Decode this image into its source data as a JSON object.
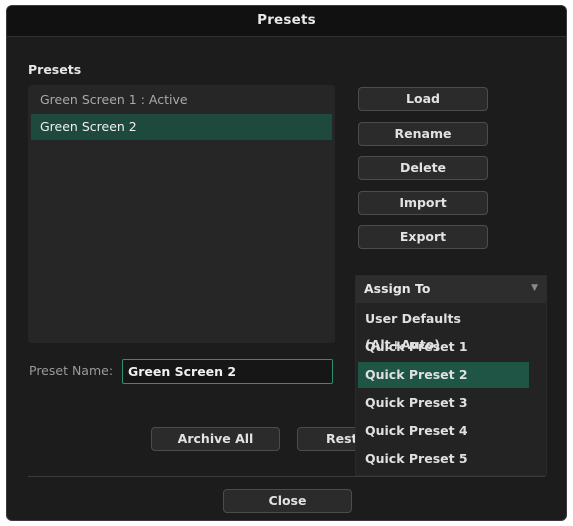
{
  "dialog": {
    "title": "Presets",
    "section_label": "Presets",
    "presets": [
      "Green Screen 1 : Active",
      "Green Screen 2"
    ],
    "selected_preset_index": 1,
    "buttons": {
      "load": "Load",
      "rename": "Rename",
      "delete": "Delete",
      "import": "Import",
      "export": "Export",
      "archive_all": "Archive All",
      "restore": "Resto",
      "close": "Close"
    },
    "preset_name": {
      "label": "Preset Name:",
      "value": "Green Screen 2"
    }
  },
  "assign_dropdown": {
    "label": "Assign To",
    "arrow_icon": "triangle-down-icon",
    "options": [
      "User Defaults (Alt+Auto)",
      "Quick Preset 1",
      "Quick Preset 2",
      "Quick Preset 3",
      "Quick Preset 4",
      "Quick Preset 5"
    ],
    "highlighted_index": 2
  },
  "colors": {
    "dialog_bg": "#1c1c1c",
    "selection": "#1e4a3e",
    "input_border": "#2f8f6e",
    "dropdown_highlight": "#1f5544"
  }
}
